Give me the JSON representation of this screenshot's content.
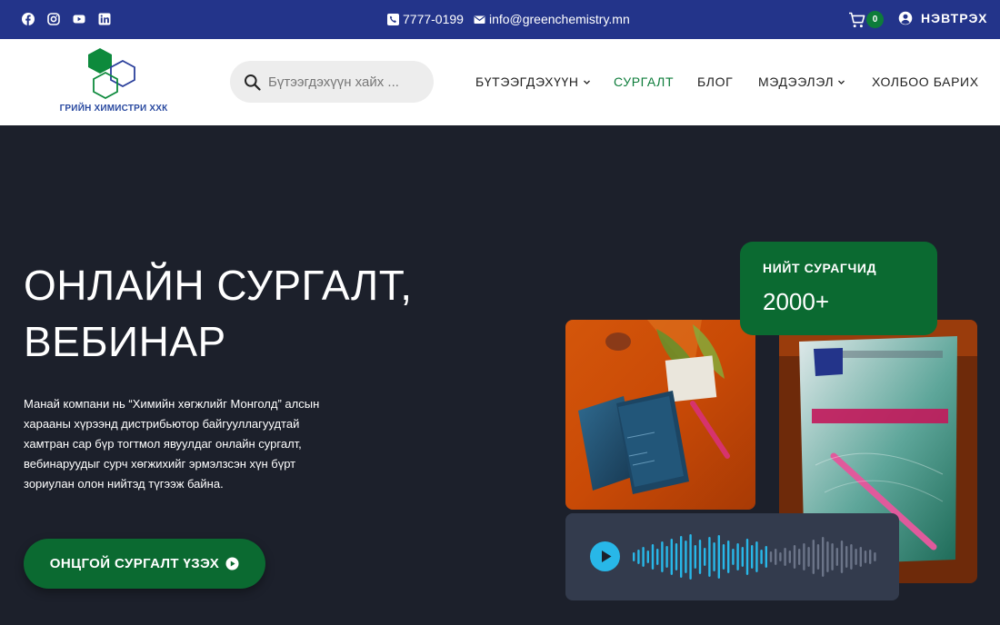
{
  "topbar": {
    "social": [
      "facebook-icon",
      "instagram-icon",
      "youtube-icon",
      "linkedin-icon"
    ],
    "phone": "7777-0199",
    "email": "info@greenchemistry.mn",
    "cart_count": "0",
    "login_label": "НЭВТРЭХ"
  },
  "header": {
    "logo_text": "ГРИЙН ХИМИСТРИ ХХК",
    "search_placeholder": "Бүтээгдэхүүн хайх ...",
    "nav": [
      {
        "label": "БҮТЭЭГДЭХҮҮН"
      },
      {
        "label": "СУРГАЛТ"
      },
      {
        "label": "БЛОГ"
      },
      {
        "label": "МЭДЭЭЛЭЛ"
      },
      {
        "label": "ХОЛБОО БАРИХ"
      }
    ]
  },
  "hero": {
    "title_line1": "ОНЛАЙН СУРГАЛТ,",
    "title_line2": "ВЕБИНАР",
    "description": "Манай компани нь “Химийн хөгжлийг Монголд” алсын харааны хүрээнд дистрибьютор байгууллагуудтай хамтран сар бүр тогтмол явуулдаг онлайн сургалт, вебинаруудыг сурч хөгжихийг эрмэлзсэн хүн бүрт зориулан олон нийтэд түгээж байна.",
    "cta_label": "ОНЦГОЙ СУРГАЛТ ҮЗЭХ",
    "stat_label": "НИЙТ СУРАГЧИД",
    "stat_value": "2000+"
  },
  "colors": {
    "topbar": "#23348a",
    "accent_green": "#0b6a31",
    "hero_bg": "#1c202b",
    "audio_card": "#333b4d",
    "play": "#28b7e8"
  }
}
